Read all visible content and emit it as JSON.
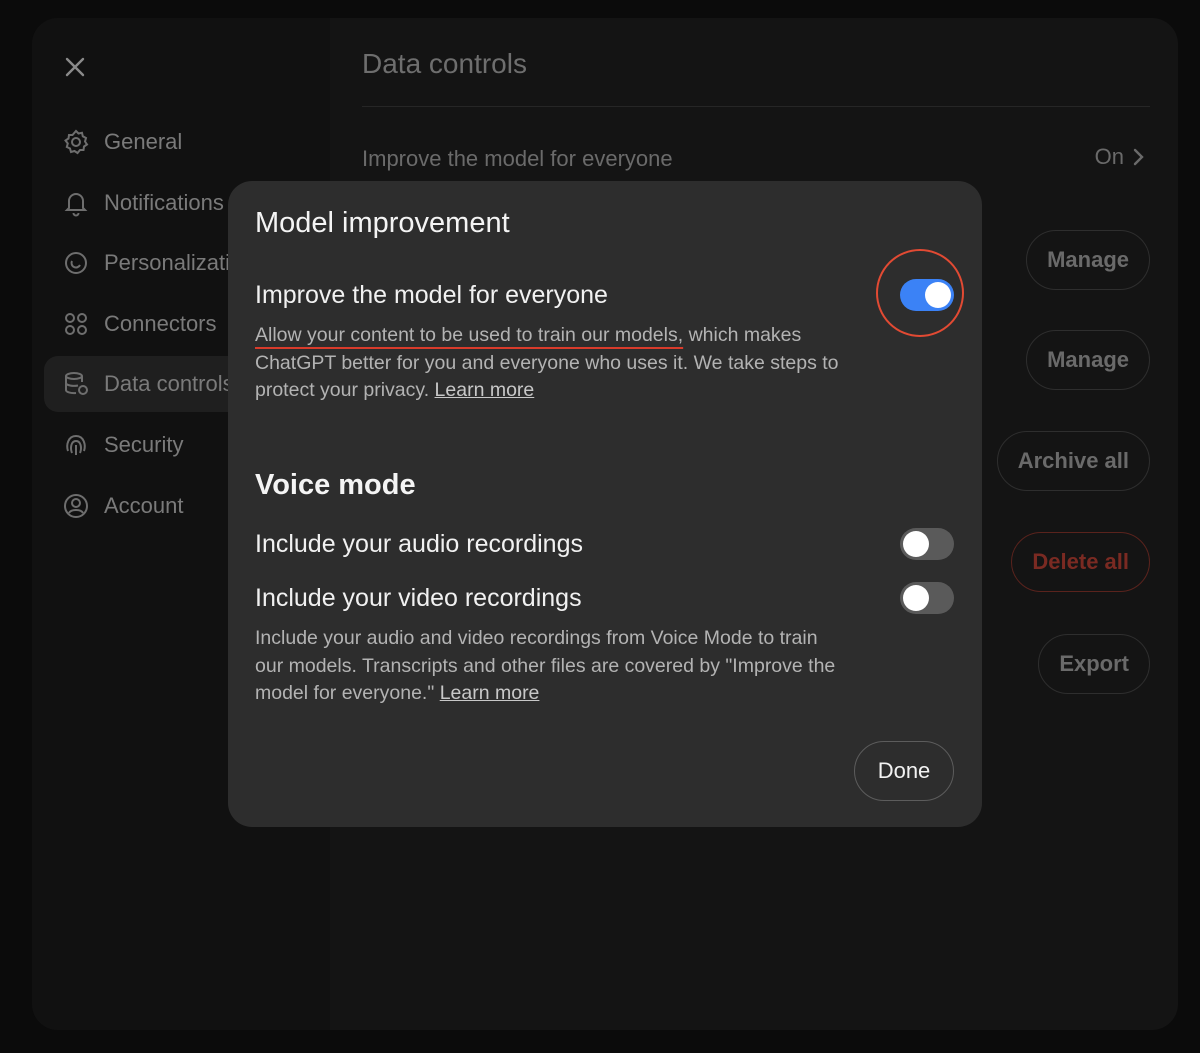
{
  "sidebar": {
    "items": [
      {
        "label": "General",
        "icon": "gear-icon"
      },
      {
        "label": "Notifications",
        "icon": "bell-icon"
      },
      {
        "label": "Personalization",
        "icon": "personalization-icon"
      },
      {
        "label": "Connectors",
        "icon": "connectors-icon"
      },
      {
        "label": "Data controls",
        "icon": "database-icon",
        "active": true
      },
      {
        "label": "Security",
        "icon": "fingerprint-icon"
      },
      {
        "label": "Account",
        "icon": "user-circle-icon"
      }
    ]
  },
  "main": {
    "title": "Data controls",
    "improve_row": {
      "label": "Improve the model for everyone",
      "value": "On"
    },
    "buttons": {
      "manage_1": "Manage",
      "manage_2": "Manage",
      "archive_all": "Archive all",
      "delete_all": "Delete all",
      "export": "Export"
    }
  },
  "modal": {
    "title": "Model improvement",
    "improve": {
      "title": "Improve the model for everyone",
      "desc_highlight": "Allow your content to be used to train our models,",
      "desc_rest": " which makes ChatGPT better for you and everyone who uses it. We take steps to protect your privacy. ",
      "learn_more": "Learn more",
      "enabled": true
    },
    "voice": {
      "section_title": "Voice mode",
      "audio_label": "Include your audio recordings",
      "audio_enabled": false,
      "video_label": "Include your video recordings",
      "video_enabled": false,
      "desc": "Include your audio and video recordings from Voice Mode to train our models. Transcripts and other files are covered by \"Improve the model for everyone.\" ",
      "learn_more": "Learn more"
    },
    "done_label": "Done"
  },
  "colors": {
    "toggle_on": "#3b82f6",
    "toggle_off": "#5a5a5a",
    "highlight": "#e24a33"
  }
}
